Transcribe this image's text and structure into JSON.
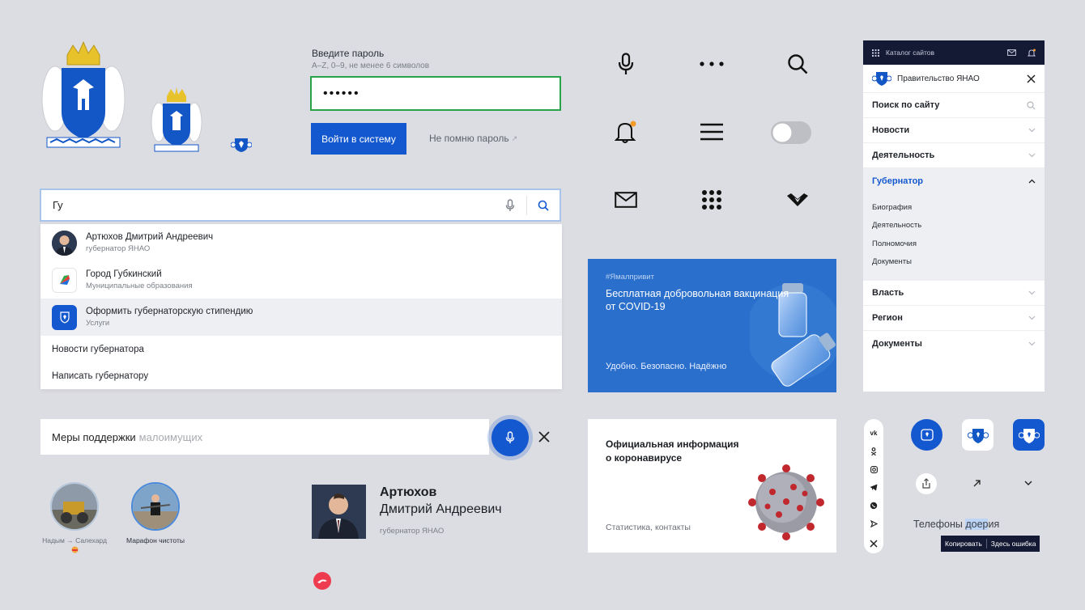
{
  "password": {
    "label": "Введите пароль",
    "hint": "A–Z, 0–9, не менее 6 символов",
    "value": "••••••",
    "login_button": "Войти в систему",
    "forgot_link": "Не помню пароль"
  },
  "search": {
    "query": "Гу",
    "results": [
      {
        "title": "Артюхов Дмитрий Андреевич",
        "subtitle": "губернатор ЯНАО"
      },
      {
        "title": "Город Губкинский",
        "subtitle": "Муниципальные образования"
      },
      {
        "title": "Оформить губернаторскую стипендию",
        "subtitle": "Услуги"
      }
    ],
    "suggestions": [
      "Новости губернатора",
      "Написать губернатору"
    ]
  },
  "support": {
    "text": "Меры поддержки",
    "muted": "малоимущих"
  },
  "stories": [
    {
      "label": "Надым → Салехард"
    },
    {
      "label": "Марафон чистоты"
    }
  ],
  "person": {
    "surname": "Артюхов",
    "name": "Дмитрий Андреевич",
    "role": "губернатор ЯНАО"
  },
  "icons": [
    "microphone-icon",
    "more-dots-icon",
    "search-icon",
    "bell-icon",
    "hamburger-icon",
    "toggle-switch",
    "mail-icon",
    "apps-grid-icon",
    "logo-chevron-icon"
  ],
  "promo_vaccine": {
    "tag": "#Ямалпривит",
    "title_line1": "Бесплатная добровольная вакцинация",
    "title_line2": "от COVID-19",
    "bottom": "Удобно. Безопасно. Надёжно"
  },
  "promo_corona": {
    "title_line1": "Официальная информация",
    "title_line2": "о коронавирусе",
    "bottom": "Статистика, контакты"
  },
  "menu": {
    "catalog": "Каталог сайтов",
    "site_title": "Правительство ЯНАО",
    "search_label": "Поиск по сайту",
    "items_top": [
      "Новости",
      "Деятельность"
    ],
    "open_item": "Губернатор",
    "sub_items": [
      "Биография",
      "Деятельность",
      "Полномочия",
      "Документы"
    ],
    "items_bottom": [
      "Власть",
      "Регион",
      "Документы"
    ]
  },
  "social": [
    "vk",
    "ok",
    "instagram",
    "telegram",
    "viber",
    "share-arrow",
    "close"
  ],
  "phones": {
    "before": "Телефоны ",
    "highlight": "доер",
    "after": "ия",
    "copy": "Копировать",
    "error": "Здесь ошибка"
  },
  "colors": {
    "accent": "#1458cf",
    "success": "#27a449",
    "dark": "#141a33",
    "background": "#dcdde2"
  }
}
